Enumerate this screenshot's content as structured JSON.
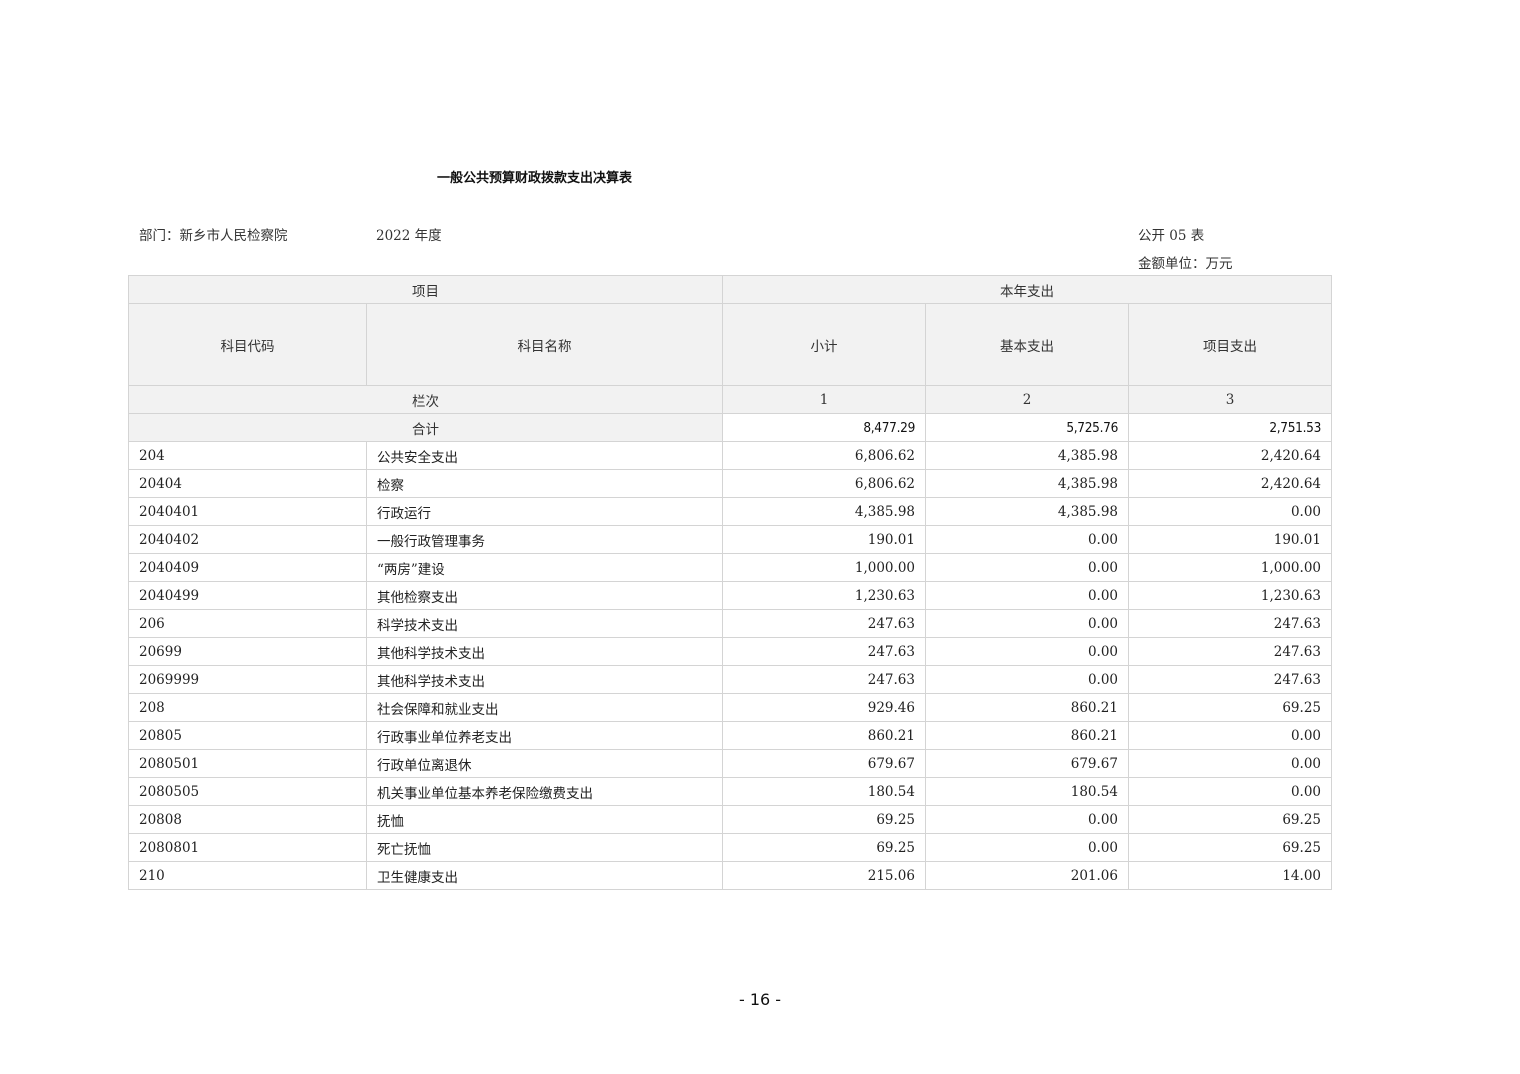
{
  "title": "一般公共预算财政拨款支出决算表",
  "department": "部门：新乡市人民检察院",
  "year": "2022 年度",
  "form_no": "公开 05 表",
  "unit": "金额单位：万元",
  "header": {
    "project": "项目",
    "current_year_expense": "本年支出",
    "code": "科目代码",
    "name": "科目名称",
    "subtotal": "小计",
    "basic": "基本支出",
    "project_expense": "项目支出",
    "column_index_label": "栏次",
    "col1": "1",
    "col2": "2",
    "col3": "3"
  },
  "total": {
    "label": "合计",
    "subtotal": "8,477.29",
    "basic": "5,725.76",
    "project": "2,751.53"
  },
  "rows": [
    {
      "code": "204",
      "name": "公共安全支出",
      "subtotal": "6,806.62",
      "basic": "4,385.98",
      "project": "2,420.64"
    },
    {
      "code": "20404",
      "name": "检察",
      "subtotal": "6,806.62",
      "basic": "4,385.98",
      "project": "2,420.64"
    },
    {
      "code": "2040401",
      "name": "行政运行",
      "subtotal": "4,385.98",
      "basic": "4,385.98",
      "project": "0.00"
    },
    {
      "code": "2040402",
      "name": "一般行政管理事务",
      "subtotal": "190.01",
      "basic": "0.00",
      "project": "190.01"
    },
    {
      "code": "2040409",
      "name": "“两房”建设",
      "subtotal": "1,000.00",
      "basic": "0.00",
      "project": "1,000.00"
    },
    {
      "code": "2040499",
      "name": "其他检察支出",
      "subtotal": "1,230.63",
      "basic": "0.00",
      "project": "1,230.63"
    },
    {
      "code": "206",
      "name": "科学技术支出",
      "subtotal": "247.63",
      "basic": "0.00",
      "project": "247.63"
    },
    {
      "code": "20699",
      "name": "其他科学技术支出",
      "subtotal": "247.63",
      "basic": "0.00",
      "project": "247.63"
    },
    {
      "code": "2069999",
      "name": "其他科学技术支出",
      "subtotal": "247.63",
      "basic": "0.00",
      "project": "247.63"
    },
    {
      "code": "208",
      "name": "社会保障和就业支出",
      "subtotal": "929.46",
      "basic": "860.21",
      "project": "69.25"
    },
    {
      "code": "20805",
      "name": "行政事业单位养老支出",
      "subtotal": "860.21",
      "basic": "860.21",
      "project": "0.00"
    },
    {
      "code": "2080501",
      "name": "行政单位离退休",
      "subtotal": "679.67",
      "basic": "679.67",
      "project": "0.00"
    },
    {
      "code": "2080505",
      "name": "机关事业单位基本养老保险缴费支出",
      "subtotal": "180.54",
      "basic": "180.54",
      "project": "0.00"
    },
    {
      "code": "20808",
      "name": "抚恤",
      "subtotal": "69.25",
      "basic": "0.00",
      "project": "69.25"
    },
    {
      "code": "2080801",
      "name": "死亡抚恤",
      "subtotal": "69.25",
      "basic": "0.00",
      "project": "69.25"
    },
    {
      "code": "210",
      "name": "卫生健康支出",
      "subtotal": "215.06",
      "basic": "201.06",
      "project": "14.00"
    }
  ],
  "page_number": "- 16 -"
}
